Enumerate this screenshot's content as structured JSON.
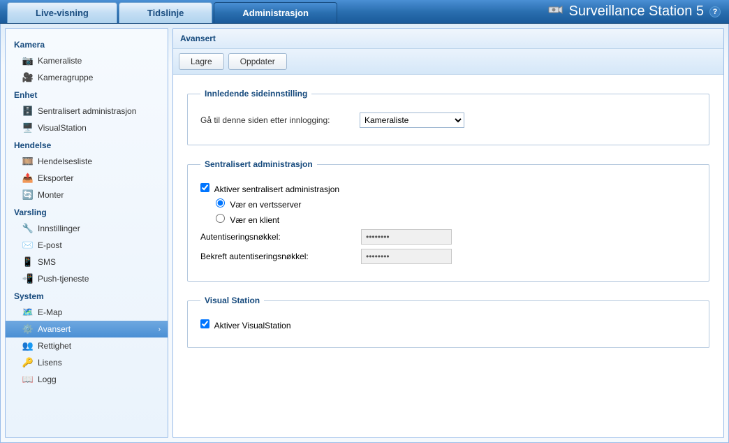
{
  "header": {
    "tabs": {
      "live": "Live-visning",
      "timeline": "Tidslinje",
      "admin": "Administrasjon"
    },
    "title": "Surveillance Station 5"
  },
  "sidebar": {
    "camera": {
      "title": "Kamera",
      "list": "Kameraliste",
      "group": "Kameragruppe"
    },
    "device": {
      "title": "Enhet",
      "cms": "Sentralisert administrasjon",
      "vs": "VisualStation"
    },
    "event": {
      "title": "Hendelse",
      "list": "Hendelsesliste",
      "export": "Eksporter",
      "mount": "Monter"
    },
    "notify": {
      "title": "Varsling",
      "settings": "Innstillinger",
      "email": "E-post",
      "sms": "SMS",
      "push": "Push-tjeneste"
    },
    "system": {
      "title": "System",
      "emap": "E-Map",
      "advanced": "Avansert",
      "priv": "Rettighet",
      "license": "Lisens",
      "log": "Logg"
    }
  },
  "panel": {
    "title": "Avansert",
    "buttons": {
      "save": "Lagre",
      "refresh": "Oppdater"
    },
    "initial": {
      "legend": "Innledende sideinnstilling",
      "label": "Gå til denne siden etter innlogging:",
      "selected": "Kameraliste"
    },
    "cms": {
      "legend": "Sentralisert administrasjon",
      "enable": "Aktiver sentralisert administrasjon",
      "host": "Vær en vertsserver",
      "client": "Vær en klient",
      "auth": "Autentiseringsnøkkel:",
      "authConfirm": "Bekreft autentiseringsnøkkel:"
    },
    "vs": {
      "legend": "Visual Station",
      "enable": "Aktiver VisualStation"
    }
  }
}
